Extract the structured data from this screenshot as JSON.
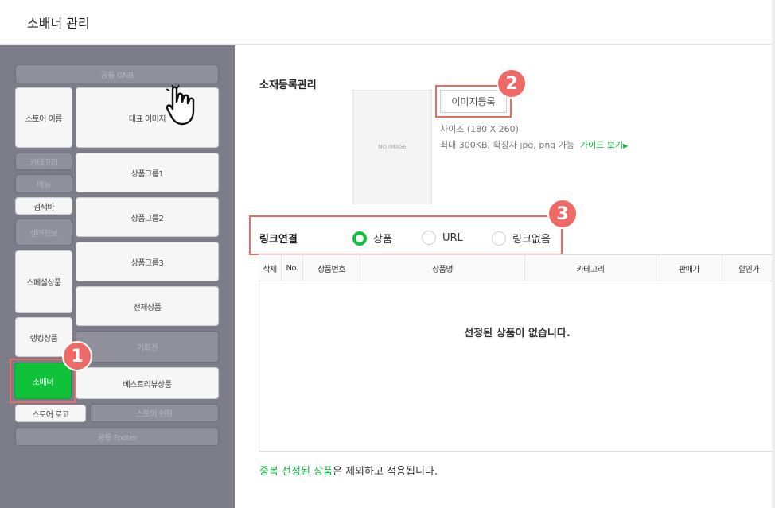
{
  "header": {
    "title": "소배너 관리"
  },
  "sidebar": {
    "gnb": "공통 GNB",
    "store_name": "스토어 이름",
    "main_image": "대표 이미지",
    "category": "카테고리",
    "menu": "메뉴",
    "search_bar": "검색바",
    "seller_info": "셀러정보",
    "special_product": "스페셜상품",
    "ranking_product": "랭킹상품",
    "small_banner": "소배너",
    "store_logo": "스토어 로고",
    "product_group_1": "상품그룹1",
    "product_group_2": "상품그룹2",
    "product_group_3": "상품그룹3",
    "all_products": "전체상품",
    "promotion": "기획전",
    "best_review_product": "베스트리뷰상품",
    "store_status": "스토어 현황",
    "footer": "공통 Footer"
  },
  "badges": {
    "one": "1",
    "two": "2",
    "three": "3"
  },
  "material": {
    "label": "소재등록관리",
    "no_image": "NO IMAGE",
    "register_button": "이미지등록",
    "size_info": "사이즈 (180 X 260)",
    "limit_info": "최대 300KB, 확장자 jpg, png 가능",
    "guide_link": "가이드 보기"
  },
  "link": {
    "label": "링크연결",
    "options": [
      {
        "label": "상품",
        "selected": true
      },
      {
        "label": "URL",
        "selected": false
      },
      {
        "label": "링크없음",
        "selected": false
      }
    ]
  },
  "table": {
    "columns": [
      "삭제",
      "No.",
      "상품번호",
      "상품명",
      "카테고리",
      "판매가",
      "할인가"
    ],
    "empty_message": "선정된 상품이 없습니다."
  },
  "footnote": {
    "highlight": "중복 선정된 상품",
    "rest": "은 제외하고 적용됩니다."
  },
  "colors": {
    "accent": "#10c13a",
    "highlight": "#ef6a66",
    "sidebar_bg": "#7c7d88"
  }
}
